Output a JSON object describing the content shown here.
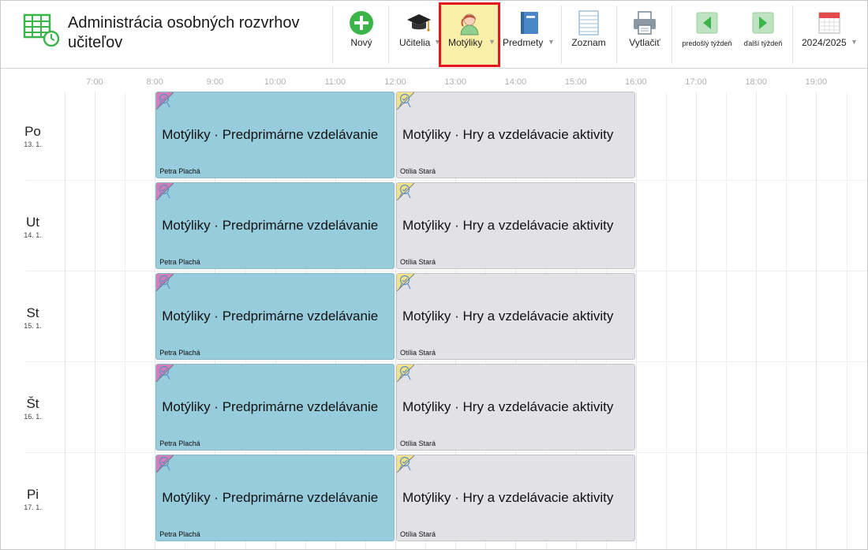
{
  "app": {
    "title": "Administrácia osobných rozvrhov učiteľov"
  },
  "toolbar": {
    "new_label": "Nový",
    "teachers_label": "Učitelia",
    "class_label": "Motýliky",
    "subjects_label": "Predmety",
    "list_label": "Zoznam",
    "print_label": "Vytlačiť",
    "prev_week_label": "predošlý týždeň",
    "next_week_label": "ďalší týždeň",
    "year_label": "2024/2025",
    "caret": "▼"
  },
  "timeline": {
    "hours": [
      "7:00",
      "8:00",
      "9:00",
      "10:00",
      "11:00",
      "12:00",
      "13:00",
      "14:00",
      "15:00",
      "16:00",
      "17:00",
      "18:00",
      "19:00"
    ]
  },
  "days": [
    {
      "name": "Po",
      "date": "13. 1."
    },
    {
      "name": "Ut",
      "date": "14. 1."
    },
    {
      "name": "St",
      "date": "15. 1."
    },
    {
      "name": "Št",
      "date": "16. 1."
    },
    {
      "name": "Pi",
      "date": "17. 1."
    }
  ],
  "lessons": {
    "morning": {
      "title": "Motýliky · Predprimárne vzdelávanie",
      "teacher": "Petra Plachá",
      "start": "8:00",
      "end": "12:00"
    },
    "afternoon": {
      "title": "Motýliky · Hry a vzdelávacie aktivity",
      "teacher": "Otília Stará",
      "start": "12:00",
      "end": "16:00"
    }
  },
  "colors": {
    "active_highlight": "#f9efa9",
    "active_outline": "#e4161e",
    "morning_card": "#96ccdc",
    "afternoon_card": "#e2e1e6",
    "morning_corner": "#d17fb9",
    "afternoon_corner": "#f2e38a",
    "accent_green": "#3bb54a"
  }
}
